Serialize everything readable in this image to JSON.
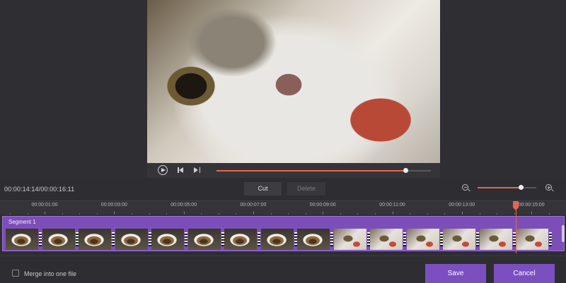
{
  "player": {
    "progress_fraction": 0.881,
    "current_time": "00:00:14:14",
    "total_time": "00:00:16:11",
    "time_display": "00:00:14:14/00:00:16:11"
  },
  "toolbar": {
    "cut_label": "Cut",
    "delete_label": "Delete"
  },
  "zoom": {
    "level_fraction": 0.73
  },
  "timeline": {
    "ticks": [
      "00:00:01:00",
      "00:00:03:00",
      "00:00:05:00",
      "00:00:07:00",
      "00:00:09:00",
      "00:00:11:00",
      "00:00:13:00",
      "00:00:15:00"
    ],
    "segment_label": "Segment 1",
    "thumbnail_count": 15
  },
  "footer": {
    "merge_label": "Merge into one file",
    "merge_checked": false,
    "save_label": "Save",
    "cancel_label": "Cancel"
  },
  "colors": {
    "accent": "#e8654f",
    "segment": "#7c4fb8",
    "button": "#7b4fc0"
  }
}
